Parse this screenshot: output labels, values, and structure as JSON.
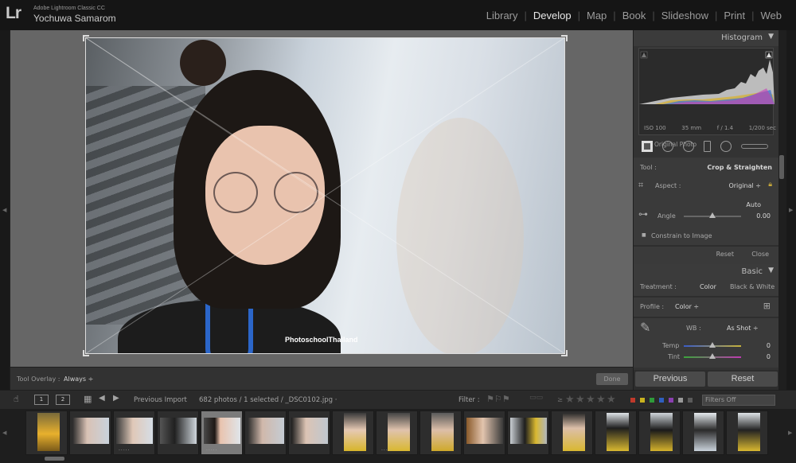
{
  "app": {
    "logo": "Lr",
    "product": "Adobe Lightroom Classic CC",
    "user": "Yochuwa Samarom"
  },
  "modules": [
    {
      "label": "Library",
      "active": false
    },
    {
      "label": "Develop",
      "active": true
    },
    {
      "label": "Map",
      "active": false
    },
    {
      "label": "Book",
      "active": false
    },
    {
      "label": "Slideshow",
      "active": false
    },
    {
      "label": "Print",
      "active": false
    },
    {
      "label": "Web",
      "active": false
    }
  ],
  "photo": {
    "watermark": "PhotoschoolThailand"
  },
  "toolbar": {
    "overlay_label": "Tool Overlay :",
    "overlay_value": "Always ÷",
    "done_label": "Done"
  },
  "histogram": {
    "title": "Histogram",
    "iso": "ISO 100",
    "focal": "35 mm",
    "aperture": "f / 1.4",
    "shutter": "1/200 sec",
    "original_photo": "Original Photo"
  },
  "crop": {
    "tool_label": "Tool :",
    "tool_value": "Crop & Straighten",
    "aspect_label": "Aspect :",
    "aspect_value": "Original ÷",
    "auto_label": "Auto",
    "angle_label": "Angle",
    "angle_value": "0.00",
    "angle_level": 0.5,
    "constrain_label": "Constrain to Image",
    "reset_label": "Reset",
    "close_label": "Close"
  },
  "basic": {
    "title": "Basic",
    "treatment_label": "Treatment :",
    "treatment_color": "Color",
    "treatment_bw": "Black & White",
    "profile_label": "Profile :",
    "profile_value": "Color ÷",
    "wb_label": "WB :",
    "wb_value": "As Shot ÷",
    "temp_label": "Temp",
    "temp_value": "0",
    "temp_level": 0.5,
    "tint_label": "Tint",
    "tint_value": "0",
    "tint_level": 0.5
  },
  "nav": {
    "previous": "Previous",
    "reset": "Reset"
  },
  "filmbar": {
    "page1": "1",
    "page2": "2",
    "source": "Previous Import",
    "count": "682 photos / 1 selected / _DSC0102.jpg ·",
    "filter_label": "Filter :",
    "filters_off": "Filters Off"
  },
  "colors": {
    "accent_white": "#e8e8e8",
    "label_red": "#c0392b",
    "label_yellow": "#c9b21f",
    "label_green": "#2f9a3a",
    "label_blue": "#2f5fbf",
    "label_purple": "#8a3fb0"
  }
}
